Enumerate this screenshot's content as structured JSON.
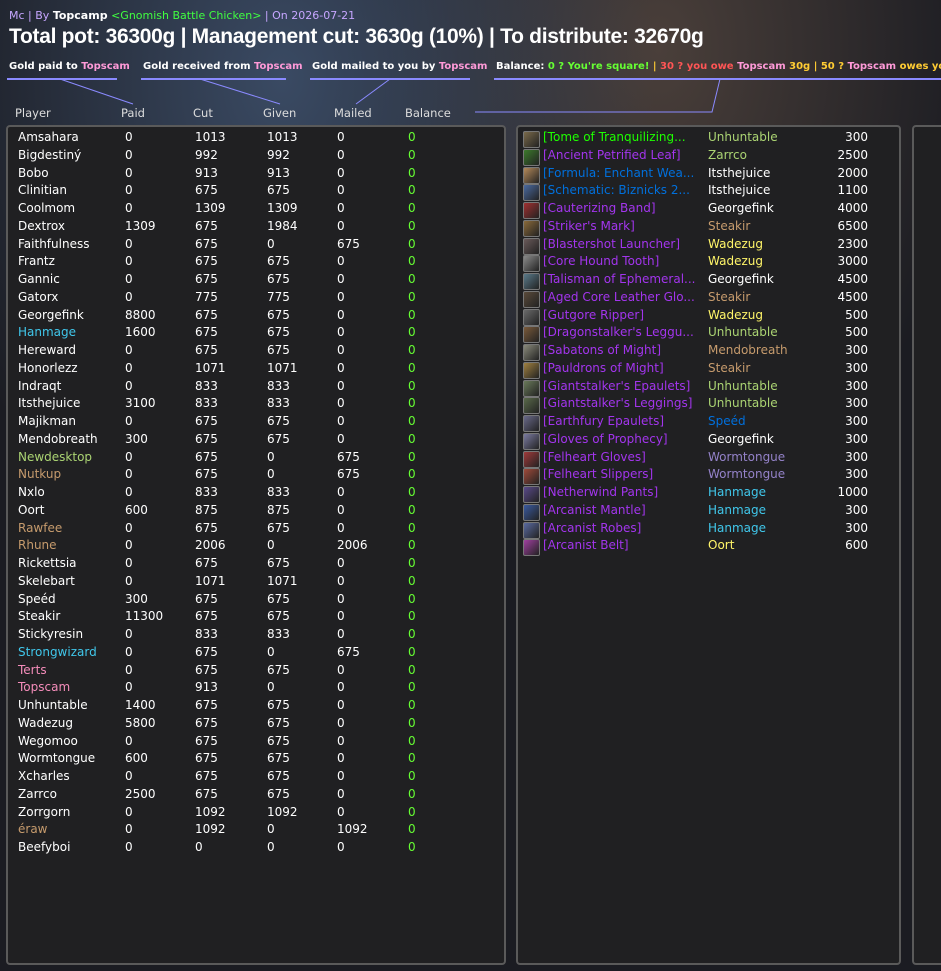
{
  "header": {
    "zone": "Mc",
    "by": "By",
    "author": "Topcamp",
    "guild": "<Gnomish Battle Chicken>",
    "date": "On 2026-07-21",
    "title": "Total pot: 36300g | Management cut: 3630g (10%) | To distribute: 32670g"
  },
  "legend": {
    "paid_prefix": "Gold paid to ",
    "received_prefix": "Gold received from ",
    "mailed_prefix": "Gold mailed to you by ",
    "target": "Topscam",
    "balance_label": "Balance:",
    "square_text": "0 ? You're square!",
    "sep": "|",
    "owe_text_a": "30 ? you owe ",
    "owe_text_b": "30g",
    "owes_text_a": "50 ? ",
    "owes_text_b": " owes you 50g"
  },
  "columns": {
    "player": "Player",
    "paid": "Paid",
    "cut": "Cut",
    "given": "Given",
    "mailed": "Mailed",
    "balance": "Balance"
  },
  "colors": {
    "white": "#ffffff",
    "blue": "#40c7eb",
    "orange": "#c69b6d",
    "pink": "#f48cba",
    "green": "#abd473",
    "balance": "#66ff33",
    "pink_name": "#ff9ad8"
  },
  "players": [
    {
      "name": "Amsahara",
      "paid": "0",
      "cut": "1013",
      "given": "1013",
      "mailed": "0",
      "balance": "0",
      "color": "#ffffff"
    },
    {
      "name": "Bigdestiný",
      "paid": "0",
      "cut": "992",
      "given": "992",
      "mailed": "0",
      "balance": "0",
      "color": "#ffffff"
    },
    {
      "name": "Bobo",
      "paid": "0",
      "cut": "913",
      "given": "913",
      "mailed": "0",
      "balance": "0",
      "color": "#ffffff"
    },
    {
      "name": "Clinitian",
      "paid": "0",
      "cut": "675",
      "given": "675",
      "mailed": "0",
      "balance": "0",
      "color": "#ffffff"
    },
    {
      "name": "Coolmom",
      "paid": "0",
      "cut": "1309",
      "given": "1309",
      "mailed": "0",
      "balance": "0",
      "color": "#ffffff"
    },
    {
      "name": "Dextrox",
      "paid": "1309",
      "cut": "675",
      "given": "1984",
      "mailed": "0",
      "balance": "0",
      "color": "#ffffff"
    },
    {
      "name": "Faithfulness",
      "paid": "0",
      "cut": "675",
      "given": "0",
      "mailed": "675",
      "balance": "0",
      "color": "#ffffff"
    },
    {
      "name": "Frantz",
      "paid": "0",
      "cut": "675",
      "given": "675",
      "mailed": "0",
      "balance": "0",
      "color": "#ffffff"
    },
    {
      "name": "Gannic",
      "paid": "0",
      "cut": "675",
      "given": "675",
      "mailed": "0",
      "balance": "0",
      "color": "#ffffff"
    },
    {
      "name": "Gatorx",
      "paid": "0",
      "cut": "775",
      "given": "775",
      "mailed": "0",
      "balance": "0",
      "color": "#ffffff"
    },
    {
      "name": "Georgefink",
      "paid": "8800",
      "cut": "675",
      "given": "675",
      "mailed": "0",
      "balance": "0",
      "color": "#ffffff"
    },
    {
      "name": "Hanmage",
      "paid": "1600",
      "cut": "675",
      "given": "675",
      "mailed": "0",
      "balance": "0",
      "color": "#40c7eb"
    },
    {
      "name": "Hereward",
      "paid": "0",
      "cut": "675",
      "given": "675",
      "mailed": "0",
      "balance": "0",
      "color": "#ffffff"
    },
    {
      "name": "Honorlezz",
      "paid": "0",
      "cut": "1071",
      "given": "1071",
      "mailed": "0",
      "balance": "0",
      "color": "#ffffff"
    },
    {
      "name": "Indraqt",
      "paid": "0",
      "cut": "833",
      "given": "833",
      "mailed": "0",
      "balance": "0",
      "color": "#ffffff"
    },
    {
      "name": "Itsthejuice",
      "paid": "3100",
      "cut": "833",
      "given": "833",
      "mailed": "0",
      "balance": "0",
      "color": "#ffffff"
    },
    {
      "name": "Majikman",
      "paid": "0",
      "cut": "675",
      "given": "675",
      "mailed": "0",
      "balance": "0",
      "color": "#ffffff"
    },
    {
      "name": "Mendobreath",
      "paid": "300",
      "cut": "675",
      "given": "675",
      "mailed": "0",
      "balance": "0",
      "color": "#ffffff"
    },
    {
      "name": "Newdesktop",
      "paid": "0",
      "cut": "675",
      "given": "0",
      "mailed": "675",
      "balance": "0",
      "color": "#abd473"
    },
    {
      "name": "Nutkup",
      "paid": "0",
      "cut": "675",
      "given": "0",
      "mailed": "675",
      "balance": "0",
      "color": "#c69b6d"
    },
    {
      "name": "Nxlo",
      "paid": "0",
      "cut": "833",
      "given": "833",
      "mailed": "0",
      "balance": "0",
      "color": "#ffffff"
    },
    {
      "name": "Oort",
      "paid": "600",
      "cut": "875",
      "given": "875",
      "mailed": "0",
      "balance": "0",
      "color": "#ffffff"
    },
    {
      "name": "Rawfee",
      "paid": "0",
      "cut": "675",
      "given": "675",
      "mailed": "0",
      "balance": "0",
      "color": "#c69b6d"
    },
    {
      "name": "Rhune",
      "paid": "0",
      "cut": "2006",
      "given": "0",
      "mailed": "2006",
      "balance": "0",
      "color": "#c69b6d"
    },
    {
      "name": "Rickettsia",
      "paid": "0",
      "cut": "675",
      "given": "675",
      "mailed": "0",
      "balance": "0",
      "color": "#ffffff"
    },
    {
      "name": "Skelebart",
      "paid": "0",
      "cut": "1071",
      "given": "1071",
      "mailed": "0",
      "balance": "0",
      "color": "#ffffff"
    },
    {
      "name": "Speéd",
      "paid": "300",
      "cut": "675",
      "given": "675",
      "mailed": "0",
      "balance": "0",
      "color": "#ffffff"
    },
    {
      "name": "Steakir",
      "paid": "11300",
      "cut": "675",
      "given": "675",
      "mailed": "0",
      "balance": "0",
      "color": "#ffffff"
    },
    {
      "name": "Stickyresin",
      "paid": "0",
      "cut": "833",
      "given": "833",
      "mailed": "0",
      "balance": "0",
      "color": "#ffffff"
    },
    {
      "name": "Strongwizard",
      "paid": "0",
      "cut": "675",
      "given": "0",
      "mailed": "675",
      "balance": "0",
      "color": "#40c7eb"
    },
    {
      "name": "Terts",
      "paid": "0",
      "cut": "675",
      "given": "675",
      "mailed": "0",
      "balance": "0",
      "color": "#f48cba"
    },
    {
      "name": "Topscam",
      "paid": "0",
      "cut": "913",
      "given": "0",
      "mailed": "0",
      "balance": "0",
      "color": "#f48cba"
    },
    {
      "name": "Unhuntable",
      "paid": "1400",
      "cut": "675",
      "given": "675",
      "mailed": "0",
      "balance": "0",
      "color": "#ffffff"
    },
    {
      "name": "Wadezug",
      "paid": "5800",
      "cut": "675",
      "given": "675",
      "mailed": "0",
      "balance": "0",
      "color": "#ffffff"
    },
    {
      "name": "Wegomoo",
      "paid": "0",
      "cut": "675",
      "given": "675",
      "mailed": "0",
      "balance": "0",
      "color": "#ffffff"
    },
    {
      "name": "Wormtongue",
      "paid": "600",
      "cut": "675",
      "given": "675",
      "mailed": "0",
      "balance": "0",
      "color": "#ffffff"
    },
    {
      "name": "Xcharles",
      "paid": "0",
      "cut": "675",
      "given": "675",
      "mailed": "0",
      "balance": "0",
      "color": "#ffffff"
    },
    {
      "name": "Zarrco",
      "paid": "2500",
      "cut": "675",
      "given": "675",
      "mailed": "0",
      "balance": "0",
      "color": "#ffffff"
    },
    {
      "name": "Zorrgorn",
      "paid": "0",
      "cut": "1092",
      "given": "1092",
      "mailed": "0",
      "balance": "0",
      "color": "#ffffff"
    },
    {
      "name": "éraw",
      "paid": "0",
      "cut": "1092",
      "given": "0",
      "mailed": "1092",
      "balance": "0",
      "color": "#c69b6d"
    },
    {
      "name": "Beefyboi",
      "paid": "0",
      "cut": "0",
      "given": "0",
      "mailed": "0",
      "balance": "0",
      "color": "#ffffff"
    }
  ],
  "loot": [
    {
      "item": "[Tome of Tranquilizing...",
      "item_color": "#1eff00",
      "winner": "Unhuntable",
      "winner_color": "#abd473",
      "price": "300",
      "icon_color": "#7a6a4a"
    },
    {
      "item": "[Ancient Petrified Leaf]",
      "item_color": "#a335ee",
      "winner": "Zarrco",
      "winner_color": "#abd473",
      "price": "2500",
      "icon_color": "#3c7a2c"
    },
    {
      "item": "[Formula: Enchant Wea...",
      "item_color": "#0070dd",
      "winner": "Itsthejuice",
      "winner_color": "#ffffff",
      "price": "2000",
      "icon_color": "#b58a5a"
    },
    {
      "item": "[Schematic: Biznicks 2...",
      "item_color": "#0070dd",
      "winner": "Itsthejuice",
      "winner_color": "#ffffff",
      "price": "1100",
      "icon_color": "#4a6aa0"
    },
    {
      "item": "[Cauterizing Band]",
      "item_color": "#a335ee",
      "winner": "Georgefink",
      "winner_color": "#ffffff",
      "price": "4000",
      "icon_color": "#a03030"
    },
    {
      "item": "[Striker's Mark]",
      "item_color": "#a335ee",
      "winner": "Steakir",
      "winner_color": "#c69b6d",
      "price": "6500",
      "icon_color": "#8a6a3a"
    },
    {
      "item": "[Blastershot Launcher]",
      "item_color": "#a335ee",
      "winner": "Wadezug",
      "winner_color": "#fff569",
      "price": "2300",
      "icon_color": "#6a5a5a"
    },
    {
      "item": "[Core Hound Tooth]",
      "item_color": "#a335ee",
      "winner": "Wadezug",
      "winner_color": "#fff569",
      "price": "3000",
      "icon_color": "#8a8a8a"
    },
    {
      "item": "[Talisman of Ephemeral...",
      "item_color": "#a335ee",
      "winner": "Georgefink",
      "winner_color": "#ffffff",
      "price": "4500",
      "icon_color": "#5a7a8a"
    },
    {
      "item": "[Aged Core Leather Glo...",
      "item_color": "#a335ee",
      "winner": "Steakir",
      "winner_color": "#c69b6d",
      "price": "4500",
      "icon_color": "#5a4a3a"
    },
    {
      "item": "[Gutgore Ripper]",
      "item_color": "#a335ee",
      "winner": "Wadezug",
      "winner_color": "#fff569",
      "price": "500",
      "icon_color": "#6a6a6a"
    },
    {
      "item": "[Dragonstalker's Leggu...",
      "item_color": "#a335ee",
      "winner": "Unhuntable",
      "winner_color": "#abd473",
      "price": "500",
      "icon_color": "#7a5a3a"
    },
    {
      "item": "[Sabatons of Might]",
      "item_color": "#a335ee",
      "winner": "Mendobreath",
      "winner_color": "#c69b6d",
      "price": "300",
      "icon_color": "#8a8a7a"
    },
    {
      "item": "[Pauldrons of Might]",
      "item_color": "#a335ee",
      "winner": "Steakir",
      "winner_color": "#c69b6d",
      "price": "300",
      "icon_color": "#a08040"
    },
    {
      "item": "[Giantstalker's Epaulets]",
      "item_color": "#a335ee",
      "winner": "Unhuntable",
      "winner_color": "#abd473",
      "price": "300",
      "icon_color": "#6a7a5a"
    },
    {
      "item": "[Giantstalker's Leggings]",
      "item_color": "#a335ee",
      "winner": "Unhuntable",
      "winner_color": "#abd473",
      "price": "300",
      "icon_color": "#5a6a4a"
    },
    {
      "item": "[Earthfury Epaulets]",
      "item_color": "#a335ee",
      "winner": "Speéd",
      "winner_color": "#0070de",
      "price": "300",
      "icon_color": "#6a6a8a"
    },
    {
      "item": "[Gloves of Prophecy]",
      "item_color": "#a335ee",
      "winner": "Georgefink",
      "winner_color": "#ffffff",
      "price": "300",
      "icon_color": "#7a7aa0"
    },
    {
      "item": "[Felheart Gloves]",
      "item_color": "#a335ee",
      "winner": "Wormtongue",
      "winner_color": "#9482c9",
      "price": "300",
      "icon_color": "#a03a3a"
    },
    {
      "item": "[Felheart Slippers]",
      "item_color": "#a335ee",
      "winner": "Wormtongue",
      "winner_color": "#9482c9",
      "price": "300",
      "icon_color": "#a04a3a"
    },
    {
      "item": "[Netherwind Pants]",
      "item_color": "#a335ee",
      "winner": "Hanmage",
      "winner_color": "#40c7eb",
      "price": "1000",
      "icon_color": "#5a4a8a"
    },
    {
      "item": "[Arcanist Mantle]",
      "item_color": "#a335ee",
      "winner": "Hanmage",
      "winner_color": "#40c7eb",
      "price": "300",
      "icon_color": "#3a5aa0"
    },
    {
      "item": "[Arcanist Robes]",
      "item_color": "#a335ee",
      "winner": "Hanmage",
      "winner_color": "#40c7eb",
      "price": "300",
      "icon_color": "#5a6aa0"
    },
    {
      "item": "[Arcanist Belt]",
      "item_color": "#a335ee",
      "winner": "Oort",
      "winner_color": "#fff569",
      "price": "600",
      "icon_color": "#a040a0"
    }
  ]
}
